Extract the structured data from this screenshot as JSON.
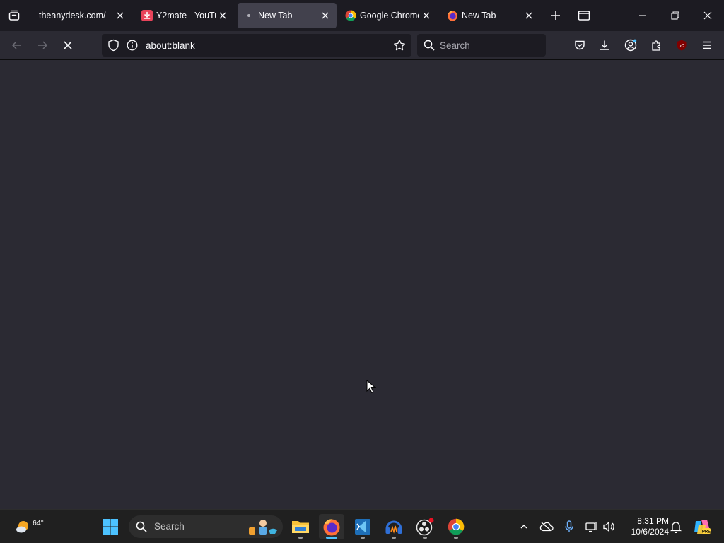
{
  "tabs": [
    {
      "title": "theanydesk.com/",
      "active": false,
      "favicon": "none"
    },
    {
      "title": "Y2mate - YouTu",
      "active": false,
      "favicon": "download-icon"
    },
    {
      "title": "New Tab",
      "active": true,
      "favicon": "loading-dot-icon"
    },
    {
      "title": "Google Chrome",
      "active": false,
      "favicon": "chrome-icon"
    },
    {
      "title": "New Tab",
      "active": false,
      "favicon": "firefox-icon"
    }
  ],
  "address_bar": {
    "url": "about:blank"
  },
  "search_bar": {
    "placeholder": "Search"
  },
  "taskbar": {
    "weather": {
      "temperature": "64°"
    },
    "search": {
      "placeholder": "Search"
    },
    "apps": [
      "windows-start",
      "file-explorer",
      "firefox",
      "vs-code-insiders",
      "headphones-app",
      "obs-studio",
      "google-chrome"
    ],
    "active_app": "firefox",
    "clock": {
      "time": "8:31 PM",
      "date": "10/6/2024"
    }
  },
  "colors": {
    "content_bg": "#2b2a33",
    "tabbar_bg": "#1c1b22",
    "active_tab_bg": "#42414d",
    "taskbar_bg": "#202020",
    "accent": "#4cc2ff"
  }
}
